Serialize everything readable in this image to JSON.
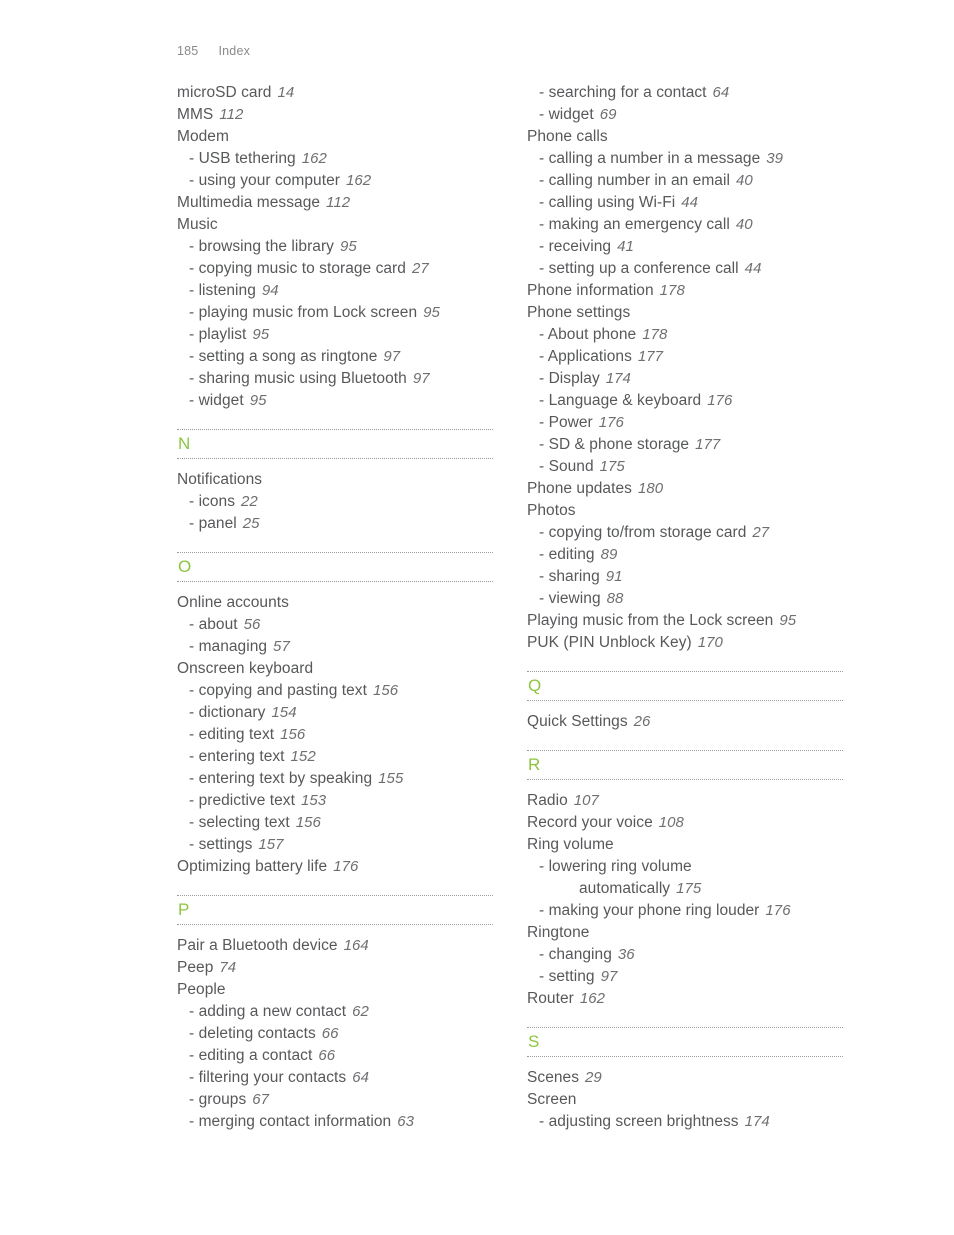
{
  "header": {
    "page_number": "185",
    "section": "Index"
  },
  "theme": {
    "letter_color": "#8cc63f",
    "text_color": "#57585a",
    "rule_color": "#9b9b9b",
    "header_color": "#8a8a8a"
  },
  "columns": [
    {
      "name": "left-column",
      "blocks": [
        {
          "type": "entries",
          "entries": [
            {
              "level": "main",
              "text": "microSD card",
              "page": "14"
            },
            {
              "level": "main",
              "text": "MMS",
              "page": "112"
            },
            {
              "level": "main",
              "text": "Modem",
              "page": ""
            },
            {
              "level": "sub",
              "text": "- USB tethering",
              "page": "162"
            },
            {
              "level": "sub",
              "text": "- using your computer",
              "page": "162"
            },
            {
              "level": "main",
              "text": "Multimedia message",
              "page": "112"
            },
            {
              "level": "main",
              "text": "Music",
              "page": ""
            },
            {
              "level": "sub",
              "text": "- browsing the library",
              "page": "95"
            },
            {
              "level": "sub",
              "text": "- copying music to storage card",
              "page": "27"
            },
            {
              "level": "sub",
              "text": "- listening",
              "page": "94"
            },
            {
              "level": "sub",
              "text": "- playing music from Lock screen",
              "page": "95"
            },
            {
              "level": "sub",
              "text": "- playlist",
              "page": "95"
            },
            {
              "level": "sub",
              "text": "- setting a song as ringtone",
              "page": "97"
            },
            {
              "level": "sub",
              "text": "- sharing music using Bluetooth",
              "page": "97"
            },
            {
              "level": "sub",
              "text": "- widget",
              "page": "95"
            }
          ]
        },
        {
          "type": "letter",
          "letter": "N"
        },
        {
          "type": "entries",
          "entries": [
            {
              "level": "main",
              "text": "Notifications",
              "page": ""
            },
            {
              "level": "sub",
              "text": "- icons",
              "page": "22"
            },
            {
              "level": "sub",
              "text": "- panel",
              "page": "25"
            }
          ]
        },
        {
          "type": "letter",
          "letter": "O"
        },
        {
          "type": "entries",
          "entries": [
            {
              "level": "main",
              "text": "Online accounts",
              "page": ""
            },
            {
              "level": "sub",
              "text": "- about",
              "page": "56"
            },
            {
              "level": "sub",
              "text": "- managing",
              "page": "57"
            },
            {
              "level": "main",
              "text": "Onscreen keyboard",
              "page": ""
            },
            {
              "level": "sub",
              "text": "- copying and pasting text",
              "page": "156"
            },
            {
              "level": "sub",
              "text": "- dictionary",
              "page": "154"
            },
            {
              "level": "sub",
              "text": "- editing text",
              "page": "156"
            },
            {
              "level": "sub",
              "text": "- entering text",
              "page": "152"
            },
            {
              "level": "sub",
              "text": "- entering text by speaking",
              "page": "155"
            },
            {
              "level": "sub",
              "text": "- predictive text",
              "page": "153"
            },
            {
              "level": "sub",
              "text": "- selecting text",
              "page": "156"
            },
            {
              "level": "sub",
              "text": "- settings",
              "page": "157"
            },
            {
              "level": "main",
              "text": "Optimizing battery life",
              "page": "176"
            }
          ]
        },
        {
          "type": "letter",
          "letter": "P"
        },
        {
          "type": "entries",
          "entries": [
            {
              "level": "main",
              "text": "Pair a Bluetooth device",
              "page": "164"
            },
            {
              "level": "main",
              "text": "Peep",
              "page": "74"
            },
            {
              "level": "main",
              "text": "People",
              "page": ""
            },
            {
              "level": "sub",
              "text": "- adding a new contact",
              "page": "62"
            },
            {
              "level": "sub",
              "text": "- deleting contacts",
              "page": "66"
            },
            {
              "level": "sub",
              "text": "- editing a contact",
              "page": "66"
            },
            {
              "level": "sub",
              "text": "- filtering your contacts",
              "page": "64"
            },
            {
              "level": "sub",
              "text": "- groups",
              "page": "67"
            },
            {
              "level": "sub",
              "text": "- merging contact information",
              "page": "63"
            }
          ]
        }
      ]
    },
    {
      "name": "right-column",
      "blocks": [
        {
          "type": "entries",
          "entries": [
            {
              "level": "sub",
              "text": "- searching for a contact",
              "page": "64"
            },
            {
              "level": "sub",
              "text": "- widget",
              "page": "69"
            },
            {
              "level": "main",
              "text": "Phone calls",
              "page": ""
            },
            {
              "level": "sub",
              "text": "- calling a number in a message",
              "page": "39"
            },
            {
              "level": "sub",
              "text": "- calling number in an email",
              "page": "40"
            },
            {
              "level": "sub",
              "text": "- calling using Wi-Fi",
              "page": "44"
            },
            {
              "level": "sub",
              "text": "- making an emergency call",
              "page": "40"
            },
            {
              "level": "sub",
              "text": "- receiving",
              "page": "41"
            },
            {
              "level": "sub",
              "text": "- setting up a conference call",
              "page": "44"
            },
            {
              "level": "main",
              "text": "Phone information",
              "page": "178"
            },
            {
              "level": "main",
              "text": "Phone settings",
              "page": ""
            },
            {
              "level": "sub",
              "text": "- About phone",
              "page": "178"
            },
            {
              "level": "sub",
              "text": "- Applications",
              "page": "177"
            },
            {
              "level": "sub",
              "text": "- Display",
              "page": "174"
            },
            {
              "level": "sub",
              "text": "- Language & keyboard",
              "page": "176"
            },
            {
              "level": "sub",
              "text": "- Power",
              "page": "176"
            },
            {
              "level": "sub",
              "text": "- SD & phone storage",
              "page": "177"
            },
            {
              "level": "sub",
              "text": "- Sound",
              "page": "175"
            },
            {
              "level": "main",
              "text": "Phone updates",
              "page": "180"
            },
            {
              "level": "main",
              "text": "Photos",
              "page": ""
            },
            {
              "level": "sub",
              "text": "- copying to/from storage card",
              "page": "27"
            },
            {
              "level": "sub",
              "text": "- editing",
              "page": "89"
            },
            {
              "level": "sub",
              "text": "- sharing",
              "page": "91"
            },
            {
              "level": "sub",
              "text": "- viewing",
              "page": "88"
            },
            {
              "level": "main",
              "text": "Playing music from the Lock screen",
              "page": "95"
            },
            {
              "level": "main",
              "text": "PUK (PIN Unblock Key)",
              "page": "170"
            }
          ]
        },
        {
          "type": "letter",
          "letter": "Q"
        },
        {
          "type": "entries",
          "entries": [
            {
              "level": "main",
              "text": "Quick Settings",
              "page": "26"
            }
          ]
        },
        {
          "type": "letter",
          "letter": "R"
        },
        {
          "type": "entries",
          "entries": [
            {
              "level": "main",
              "text": "Radio",
              "page": "107"
            },
            {
              "level": "main",
              "text": "Record your voice",
              "page": "108"
            },
            {
              "level": "main",
              "text": "Ring volume",
              "page": ""
            },
            {
              "level": "sub",
              "text": "- lowering ring volume",
              "page": ""
            },
            {
              "level": "subwrap",
              "text": "automatically",
              "page": "175"
            },
            {
              "level": "sub",
              "text": "- making your phone ring louder",
              "page": "176"
            },
            {
              "level": "main",
              "text": "Ringtone",
              "page": ""
            },
            {
              "level": "sub",
              "text": "- changing",
              "page": "36"
            },
            {
              "level": "sub",
              "text": "- setting",
              "page": "97"
            },
            {
              "level": "main",
              "text": "Router",
              "page": "162"
            }
          ]
        },
        {
          "type": "letter",
          "letter": "S"
        },
        {
          "type": "entries",
          "entries": [
            {
              "level": "main",
              "text": "Scenes",
              "page": "29"
            },
            {
              "level": "main",
              "text": "Screen",
              "page": ""
            },
            {
              "level": "sub",
              "text": "- adjusting screen brightness",
              "page": "174"
            }
          ]
        }
      ]
    }
  ]
}
